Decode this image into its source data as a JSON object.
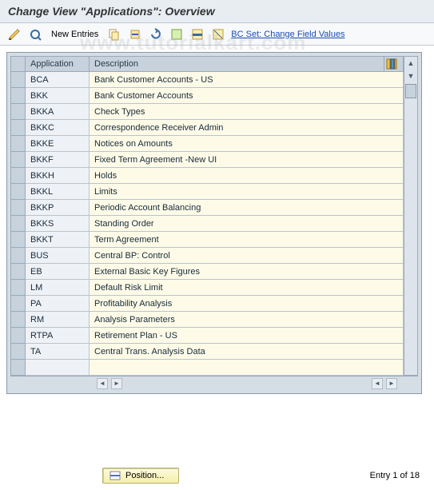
{
  "title": "Change View \"Applications\": Overview",
  "watermark": "www.tutorialkart.com",
  "toolbar": {
    "new_entries": "New Entries",
    "bcset": "BC Set: Change Field Values"
  },
  "columns": {
    "app": "Application",
    "desc": "Description"
  },
  "rows": [
    {
      "app": "BCA",
      "desc": "Bank Customer Accounts - US"
    },
    {
      "app": "BKK",
      "desc": "Bank Customer Accounts"
    },
    {
      "app": "BKKA",
      "desc": "Check Types"
    },
    {
      "app": "BKKC",
      "desc": "Correspondence Receiver Admin"
    },
    {
      "app": "BKKE",
      "desc": "Notices on Amounts"
    },
    {
      "app": "BKKF",
      "desc": "Fixed Term Agreement -New UI"
    },
    {
      "app": "BKKH",
      "desc": "Holds"
    },
    {
      "app": "BKKL",
      "desc": "Limits"
    },
    {
      "app": "BKKP",
      "desc": "Periodic Account Balancing"
    },
    {
      "app": "BKKS",
      "desc": "Standing Order"
    },
    {
      "app": "BKKT",
      "desc": "Term Agreement"
    },
    {
      "app": "BUS",
      "desc": "Central BP: Control"
    },
    {
      "app": "EB",
      "desc": "External Basic Key Figures"
    },
    {
      "app": "LM",
      "desc": "Default Risk Limit"
    },
    {
      "app": "PA",
      "desc": "Profitability Analysis"
    },
    {
      "app": "RM",
      "desc": "Analysis Parameters"
    },
    {
      "app": "RTPA",
      "desc": "Retirement Plan - US"
    },
    {
      "app": "TA",
      "desc": "Central Trans. Analysis Data"
    }
  ],
  "footer": {
    "position": "Position...",
    "entry": "Entry 1 of 18"
  }
}
